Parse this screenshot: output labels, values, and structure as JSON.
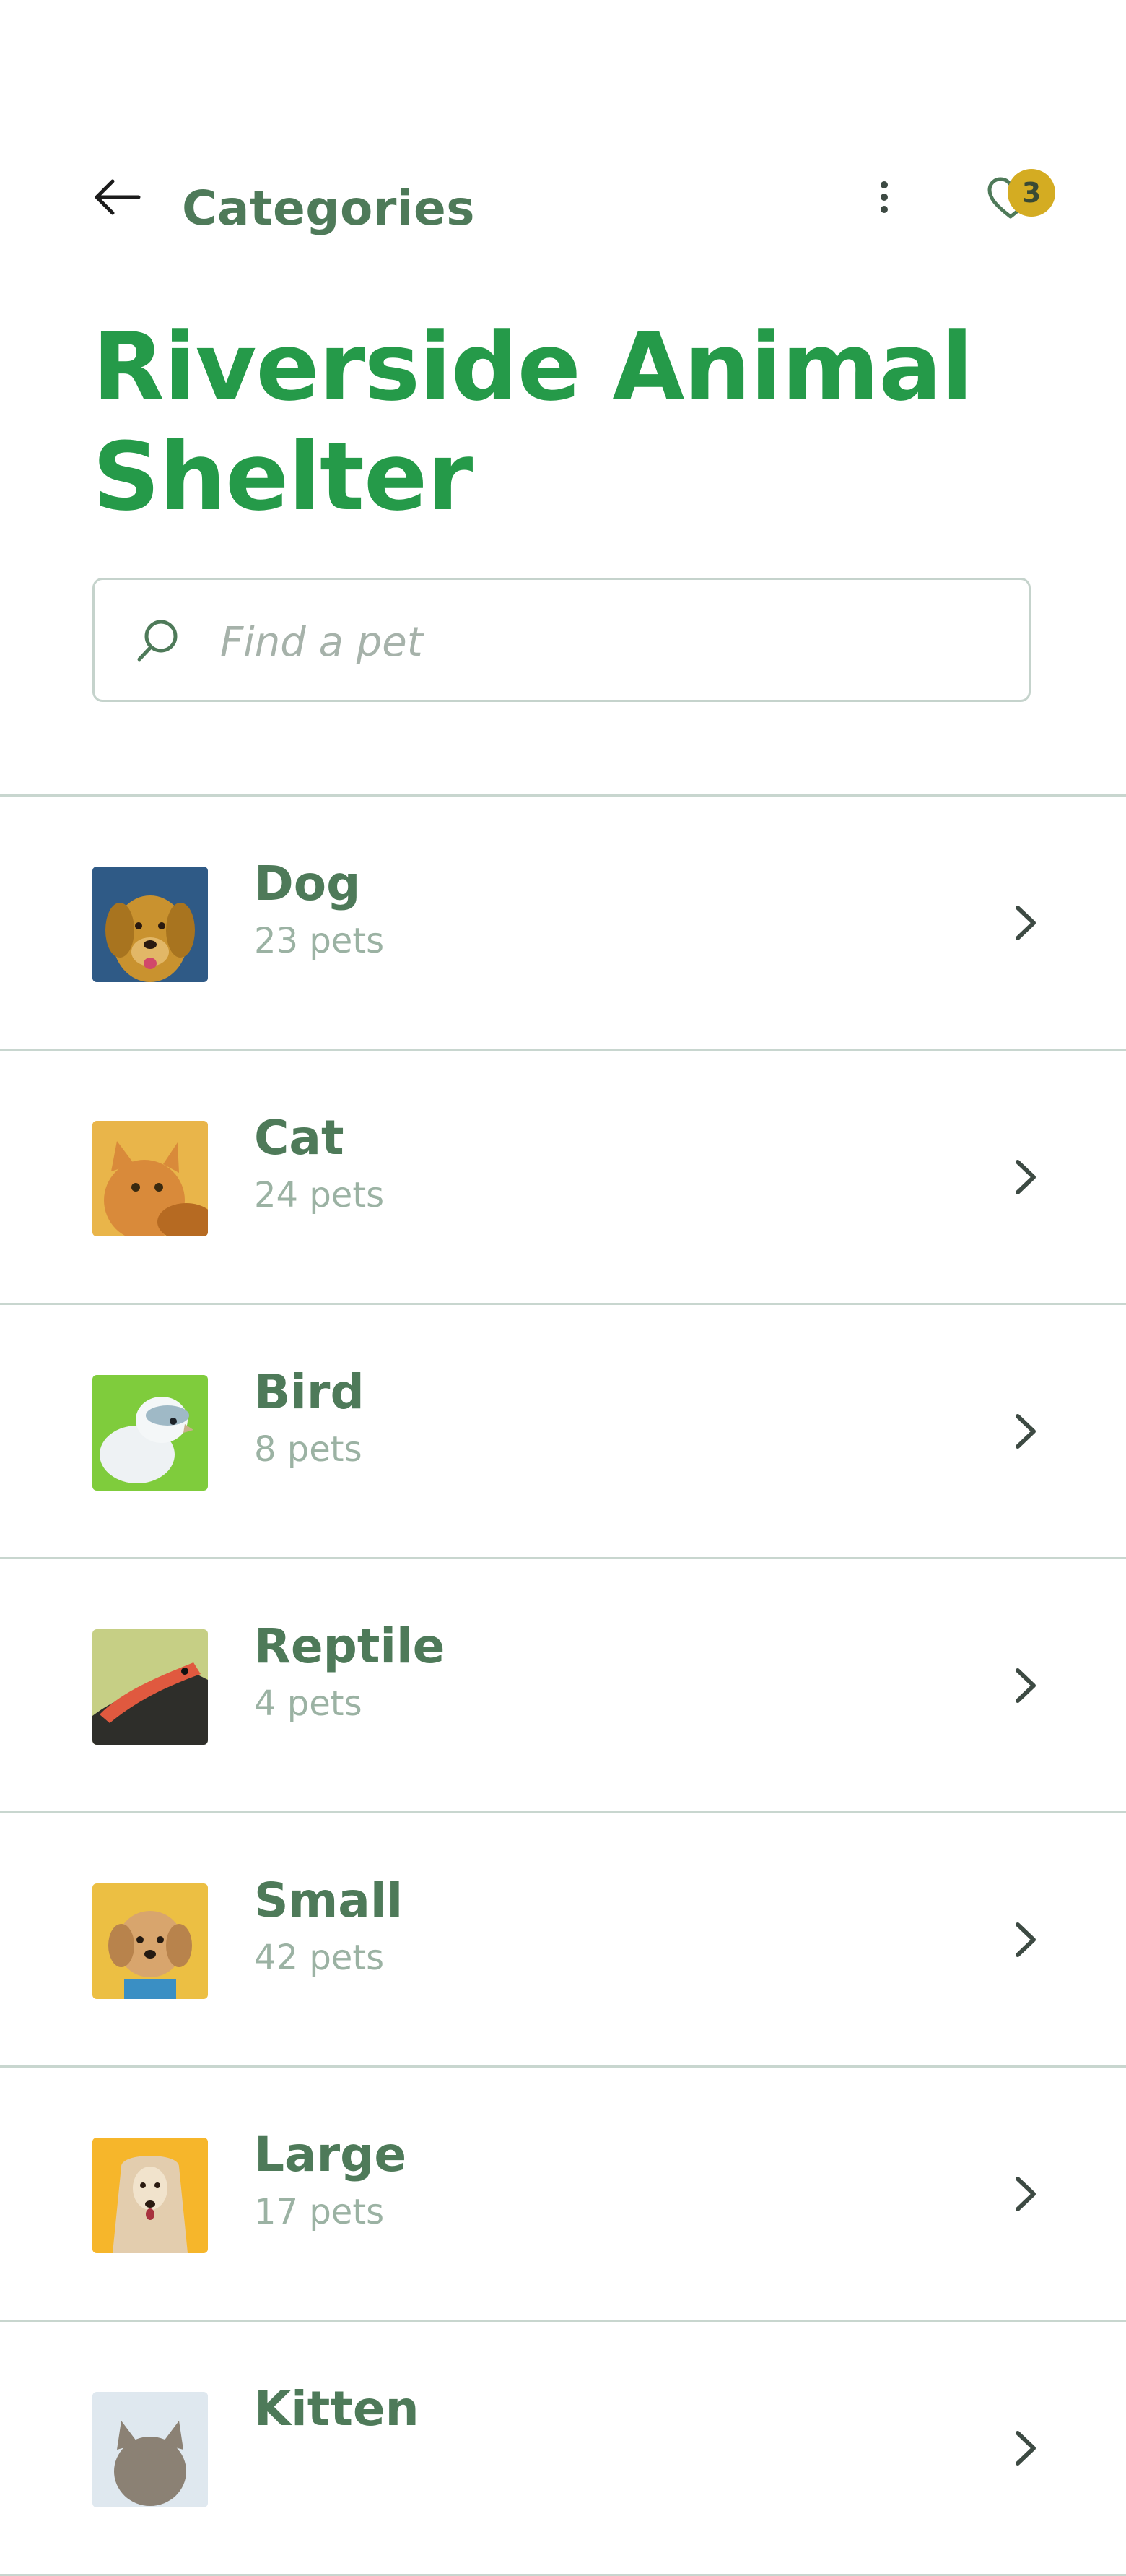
{
  "header": {
    "title": "Categories",
    "favorites_count": "3"
  },
  "shelter": {
    "name": "Riverside Animal Shelter"
  },
  "search": {
    "placeholder": "Find a pet",
    "value": ""
  },
  "categories": [
    {
      "name": "Dog",
      "count": "23 pets",
      "image": "golden-retriever-photo",
      "bg": "#2f5a86"
    },
    {
      "name": "Cat",
      "count": "24 pets",
      "image": "orange-tabby-cat-photo",
      "bg": "#e9b54a"
    },
    {
      "name": "Bird",
      "count": "8 pets",
      "image": "white-budgie-photo",
      "bg": "#7fcc3c"
    },
    {
      "name": "Reptile",
      "count": "4 pets",
      "image": "lizard-photo",
      "bg": "#c6cf85"
    },
    {
      "name": "Small",
      "count": "42 pets",
      "image": "small-dog-photo",
      "bg": "#ecbf43"
    },
    {
      "name": "Large",
      "count": "17 pets",
      "image": "afghan-hound-photo",
      "bg": "#f6b62b"
    },
    {
      "name": "Kitten",
      "count": "",
      "image": "kitten-photo",
      "bg": "#dfe8ef"
    }
  ],
  "colors": {
    "title_green": "#259a49",
    "label_green": "#4e7a59",
    "muted_green": "#9bb2a3",
    "badge_yellow": "#d4ac22",
    "divider": "#c8d6cf"
  }
}
